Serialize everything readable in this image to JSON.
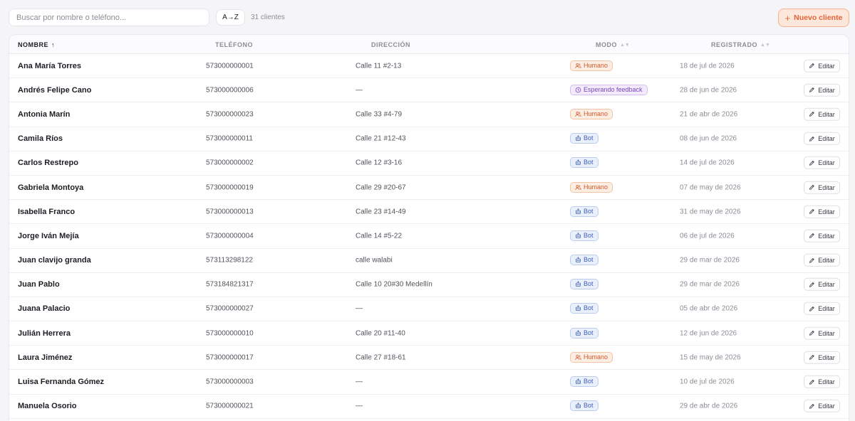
{
  "toolbar": {
    "search_placeholder": "Buscar por nombre o teléfono...",
    "search_value": "",
    "sort_label": "A→Z",
    "count_label": "31 clientes",
    "new_client_label": "Nuevo cliente"
  },
  "table": {
    "columns": {
      "name": "NOMBRE",
      "phone": "TELÉFONO",
      "address": "DIRECCIÓN",
      "mode": "MODO",
      "registered": "REGISTRADO"
    },
    "edit_label": "Editar",
    "rows": [
      {
        "name": "Ana María Torres",
        "phone": "573000000001",
        "address": "Calle 11 #2-13",
        "mode": "Humano",
        "mode_type": "humano",
        "date": "18 de jul de 2026"
      },
      {
        "name": "Andrés Felipe Cano",
        "phone": "573000000006",
        "address": "—",
        "mode": "Esperando feedback",
        "mode_type": "feedback",
        "date": "28 de jun de 2026"
      },
      {
        "name": "Antonia Marín",
        "phone": "573000000023",
        "address": "Calle 33 #4-79",
        "mode": "Humano",
        "mode_type": "humano",
        "date": "21 de abr de 2026"
      },
      {
        "name": "Camila Ríos",
        "phone": "573000000011",
        "address": "Calle 21 #12-43",
        "mode": "Bot",
        "mode_type": "bot",
        "date": "08 de jun de 2026"
      },
      {
        "name": "Carlos Restrepo",
        "phone": "573000000002",
        "address": "Calle 12 #3-16",
        "mode": "Bot",
        "mode_type": "bot",
        "date": "14 de jul de 2026"
      },
      {
        "name": "Gabriela Montoya",
        "phone": "573000000019",
        "address": "Calle 29 #20-67",
        "mode": "Humano",
        "mode_type": "humano",
        "date": "07 de may de 2026"
      },
      {
        "name": "Isabella Franco",
        "phone": "573000000013",
        "address": "Calle 23 #14-49",
        "mode": "Bot",
        "mode_type": "bot",
        "date": "31 de may de 2026"
      },
      {
        "name": "Jorge Iván Mejía",
        "phone": "573000000004",
        "address": "Calle 14 #5-22",
        "mode": "Bot",
        "mode_type": "bot",
        "date": "06 de jul de 2026"
      },
      {
        "name": "Juan clavijo granda",
        "phone": "573113298122",
        "address": "calle walabi",
        "mode": "Bot",
        "mode_type": "bot",
        "date": "29 de mar de 2026"
      },
      {
        "name": "Juan Pablo",
        "phone": "573184821317",
        "address": "Calle 10 20#30 Medellín",
        "mode": "Bot",
        "mode_type": "bot",
        "date": "29 de mar de 2026"
      },
      {
        "name": "Juana Palacio",
        "phone": "573000000027",
        "address": "—",
        "mode": "Bot",
        "mode_type": "bot",
        "date": "05 de abr de 2026"
      },
      {
        "name": "Julián Herrera",
        "phone": "573000000010",
        "address": "Calle 20 #11-40",
        "mode": "Bot",
        "mode_type": "bot",
        "date": "12 de jun de 2026"
      },
      {
        "name": "Laura Jiménez",
        "phone": "573000000017",
        "address": "Calle 27 #18-61",
        "mode": "Humano",
        "mode_type": "humano",
        "date": "15 de may de 2026"
      },
      {
        "name": "Luisa Fernanda Gómez",
        "phone": "573000000003",
        "address": "—",
        "mode": "Bot",
        "mode_type": "bot",
        "date": "10 de jul de 2026"
      },
      {
        "name": "Manuela Osorio",
        "phone": "573000000021",
        "address": "—",
        "mode": "Bot",
        "mode_type": "bot",
        "date": "29 de abr de 2026"
      }
    ]
  },
  "icons": {
    "humano": "users-icon",
    "bot": "bot-icon",
    "feedback": "clock-icon",
    "edit": "pencil-icon",
    "new": "plus-icon"
  },
  "colors": {
    "accent": "#e0643a",
    "humano": "#d0582a",
    "bot": "#3f5fb0",
    "feedback": "#7c44c0"
  }
}
